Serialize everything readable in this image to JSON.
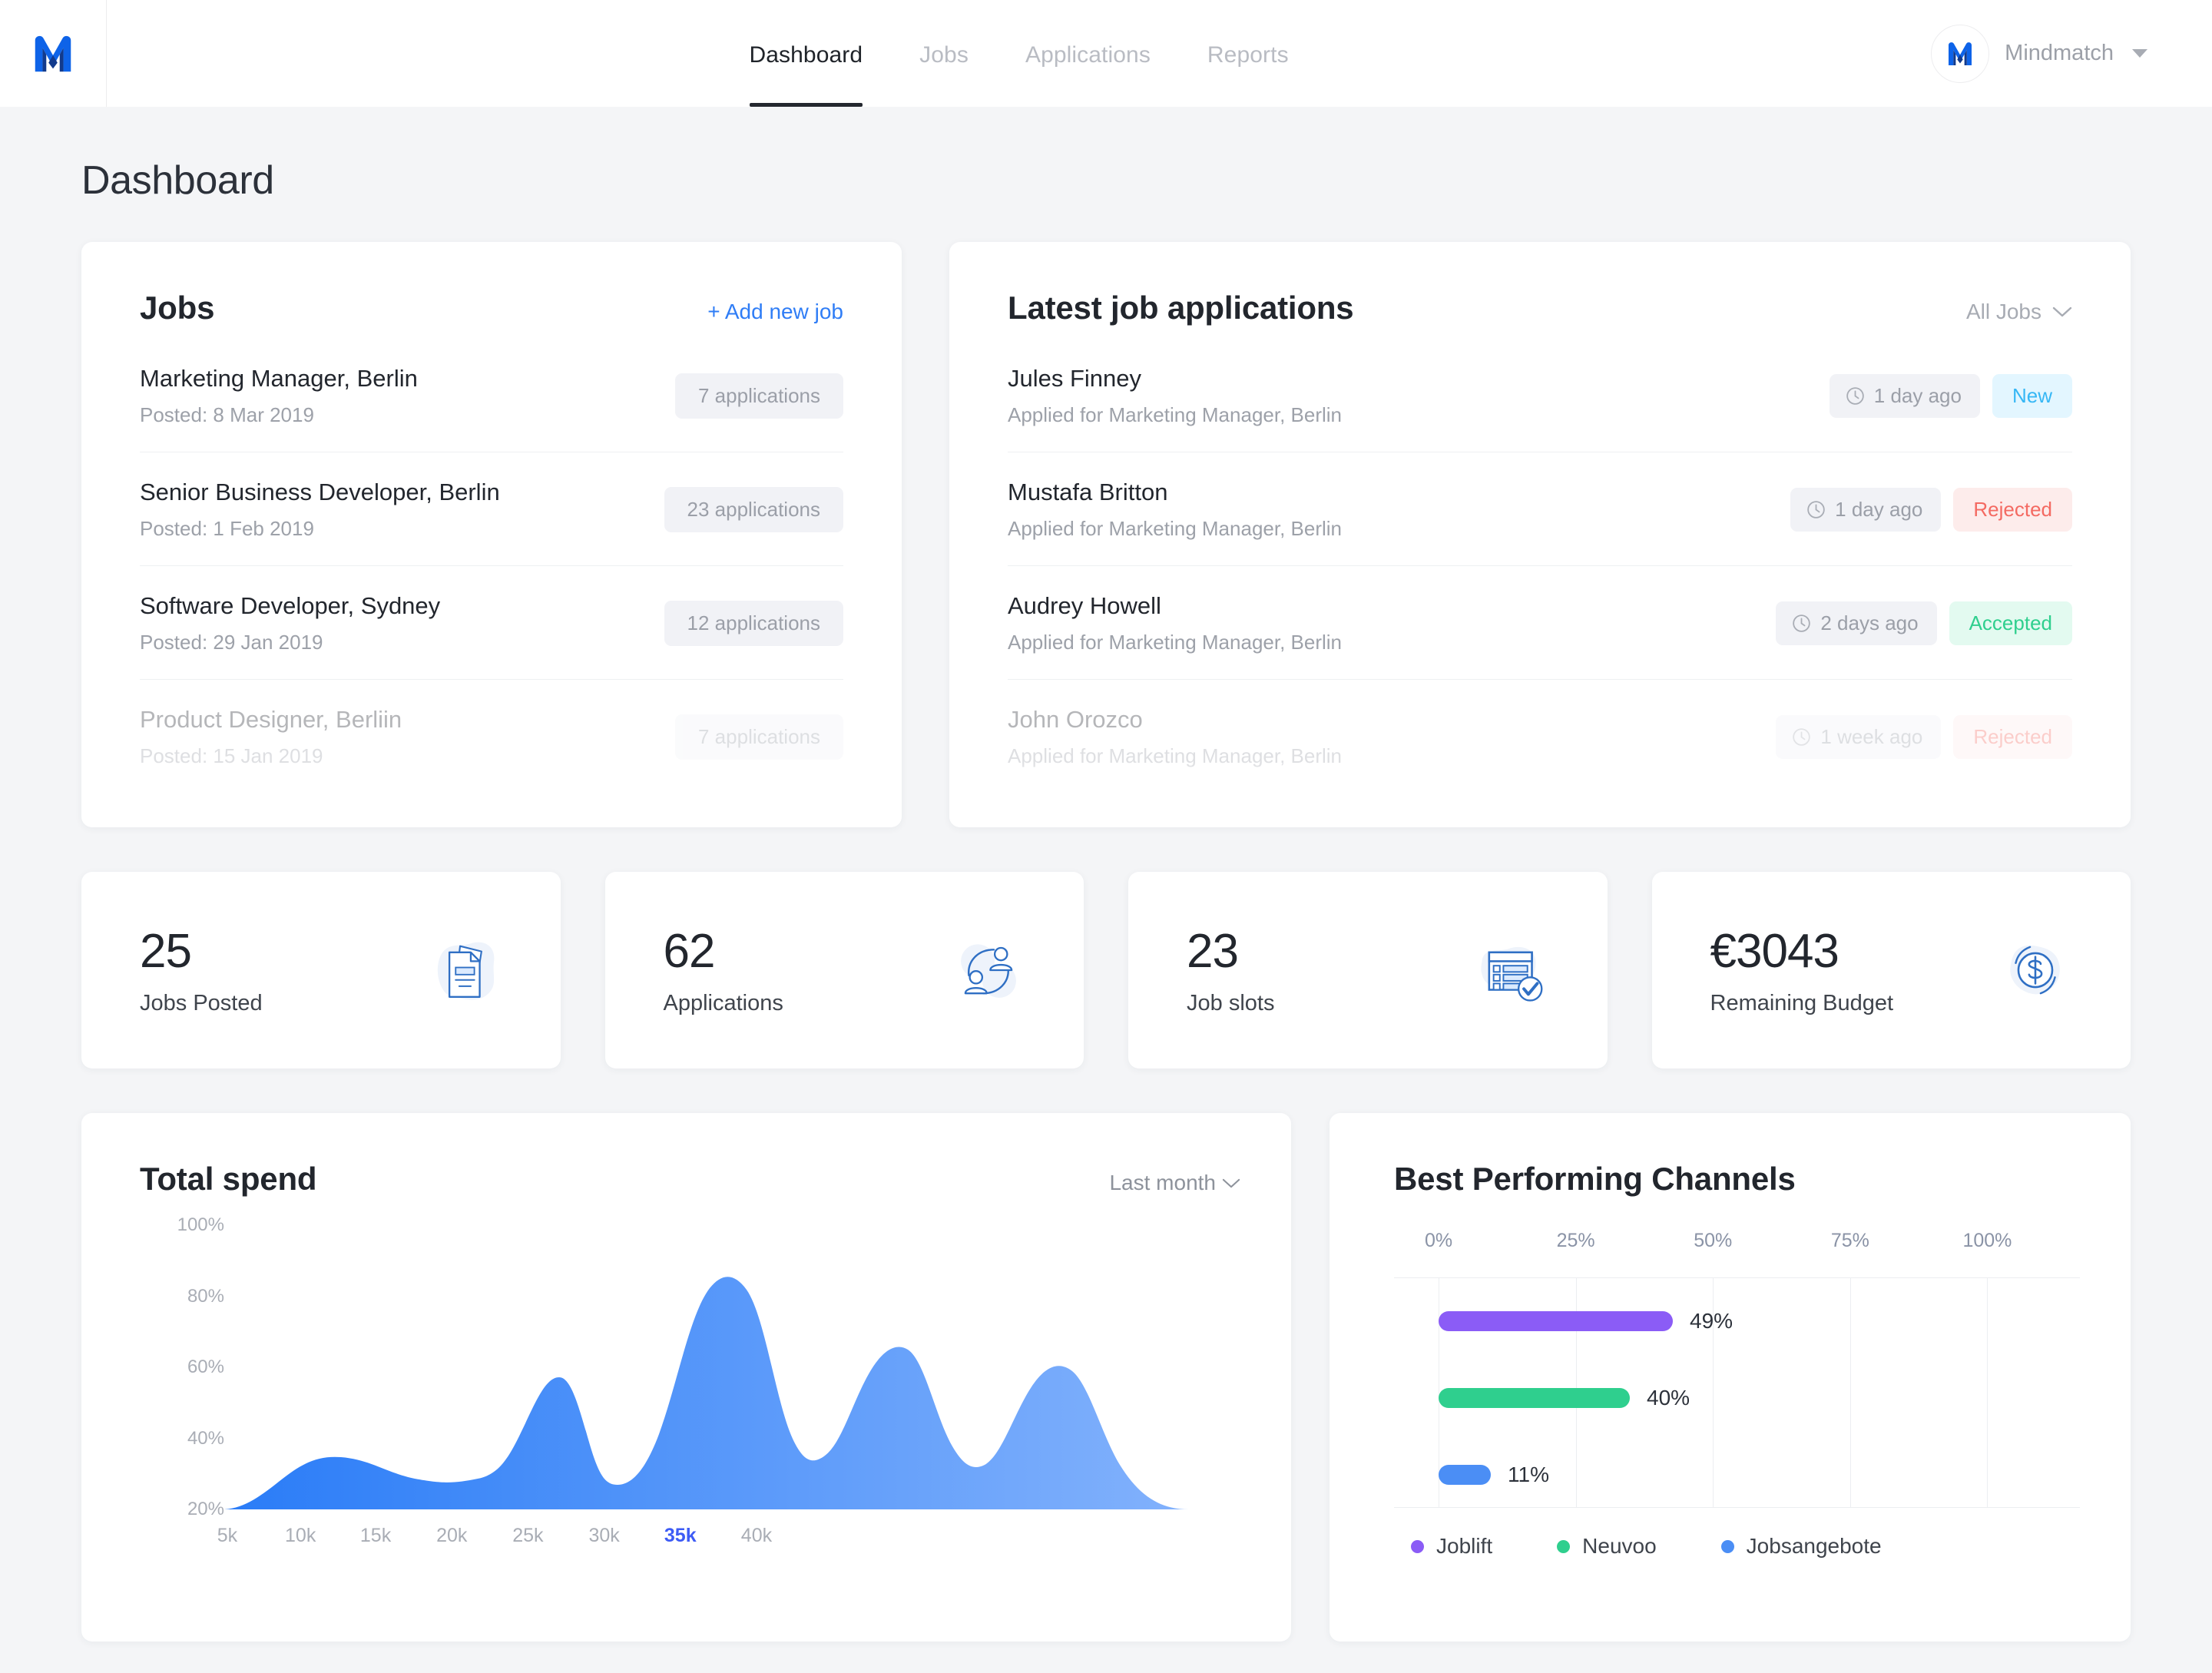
{
  "nav": {
    "logo_icon": "mindmatch-logo-icon",
    "links": [
      {
        "label": "Dashboard",
        "active": true
      },
      {
        "label": "Jobs",
        "active": false
      },
      {
        "label": "Applications",
        "active": false
      },
      {
        "label": "Reports",
        "active": false
      }
    ],
    "account": {
      "name": "Mindmatch",
      "avatar_icon": "mindmatch-avatar-icon"
    }
  },
  "page": {
    "title": "Dashboard"
  },
  "jobs_card": {
    "title": "Jobs",
    "add_label": "+ Add new job",
    "rows": [
      {
        "title": "Marketing Manager, Berlin",
        "posted": "Posted: 8 Mar 2019",
        "count": "7 applications"
      },
      {
        "title": "Senior Business Developer, Berlin",
        "posted": "Posted: 1 Feb 2019",
        "count": "23 applications"
      },
      {
        "title": "Software Developer, Sydney",
        "posted": "Posted: 29 Jan 2019",
        "count": "12 applications"
      },
      {
        "title": "Product Designer, Berliin",
        "posted": "Posted: 15 Jan 2019",
        "count": "7 applications"
      }
    ]
  },
  "applications_card": {
    "title": "Latest job applications",
    "filter_label": "All Jobs",
    "rows": [
      {
        "name": "Jules Finney",
        "applied": "Applied for Marketing Manager, Berlin",
        "time": "1 day ago",
        "status": "New",
        "status_kind": "st-new"
      },
      {
        "name": "Mustafa Britton",
        "applied": "Applied for Marketing Manager, Berlin",
        "time": "1 day ago",
        "status": "Rejected",
        "status_kind": "st-rejected"
      },
      {
        "name": "Audrey Howell",
        "applied": "Applied for Marketing Manager, Berlin",
        "time": "2 days ago",
        "status": "Accepted",
        "status_kind": "st-accepted"
      },
      {
        "name": "John Orozco",
        "applied": "Applied for Marketing Manager, Berlin",
        "time": "1 week ago",
        "status": "Rejected",
        "status_kind": "st-rejected"
      }
    ]
  },
  "stats": [
    {
      "value": "25",
      "label": "Jobs Posted",
      "icon": "documents-icon"
    },
    {
      "value": "62",
      "label": "Applications",
      "icon": "users-connected-icon"
    },
    {
      "value": "23",
      "label": "Job slots",
      "icon": "checklist-check-icon"
    },
    {
      "value": "€3043",
      "label": "Remaining Budget",
      "icon": "dollar-coin-icon"
    }
  ],
  "colors": {
    "accent_blue": "#2f7df6",
    "joblift_purple": "#8b5cf6",
    "neuvoo_green": "#2fcf8e",
    "jobsangebote_blue": "#4b8ef5",
    "highlight": "#3d5bf5"
  },
  "chart_data": [
    {
      "type": "area",
      "title": "Total spend",
      "period_label": "Last month",
      "xlabel": "",
      "ylabel": "",
      "grid": false,
      "ylim": [
        20,
        100
      ],
      "y_ticks": [
        "20%",
        "40%",
        "60%",
        "80%",
        "100%"
      ],
      "y_tick_values": [
        20,
        40,
        60,
        80,
        100
      ],
      "x_ticks": [
        "5k",
        "10k",
        "15k",
        "20k",
        "25k",
        "30k",
        "35k",
        "40k"
      ],
      "x_tick_values": [
        5000,
        10000,
        15000,
        20000,
        25000,
        30000,
        35000,
        40000
      ],
      "highlighted_x_tick": "35k",
      "x": [
        5000,
        6500,
        8500,
        10500,
        13500,
        15500,
        18000,
        19500,
        20500,
        22000,
        23800,
        25500,
        26800,
        28000,
        30800,
        32500,
        33800,
        35000,
        36800,
        38500,
        40000
      ],
      "values": [
        20,
        24,
        33,
        30,
        27,
        28,
        55,
        38,
        33,
        55,
        90,
        55,
        40,
        45,
        66,
        44,
        35,
        43,
        58,
        47,
        20
      ],
      "fill_gradient": [
        "#2a7cf7",
        "#7fb0fb"
      ]
    },
    {
      "type": "bar",
      "orientation": "horizontal",
      "title": "Best Performing Channels",
      "xlabel": "",
      "ylabel": "",
      "grid": true,
      "xlim": [
        0,
        100
      ],
      "x_ticks": [
        "0%",
        "25%",
        "50%",
        "75%",
        "100%"
      ],
      "x_tick_values": [
        0,
        25,
        50,
        75,
        100
      ],
      "legend_position": "bottom",
      "categories": [
        "Joblift",
        "Neuvoo",
        "Jobsangebote"
      ],
      "values": [
        49,
        40,
        11
      ],
      "value_labels": [
        "49%",
        "40%",
        "11%"
      ],
      "series": [
        {
          "name": "Joblift",
          "value": 49,
          "label": "49%",
          "color": "#8b5cf6"
        },
        {
          "name": "Neuvoo",
          "value": 40,
          "label": "40%",
          "color": "#2fcf8e"
        },
        {
          "name": "Jobsangebote",
          "value": 11,
          "label": "11%",
          "color": "#4b8ef5"
        }
      ]
    }
  ]
}
